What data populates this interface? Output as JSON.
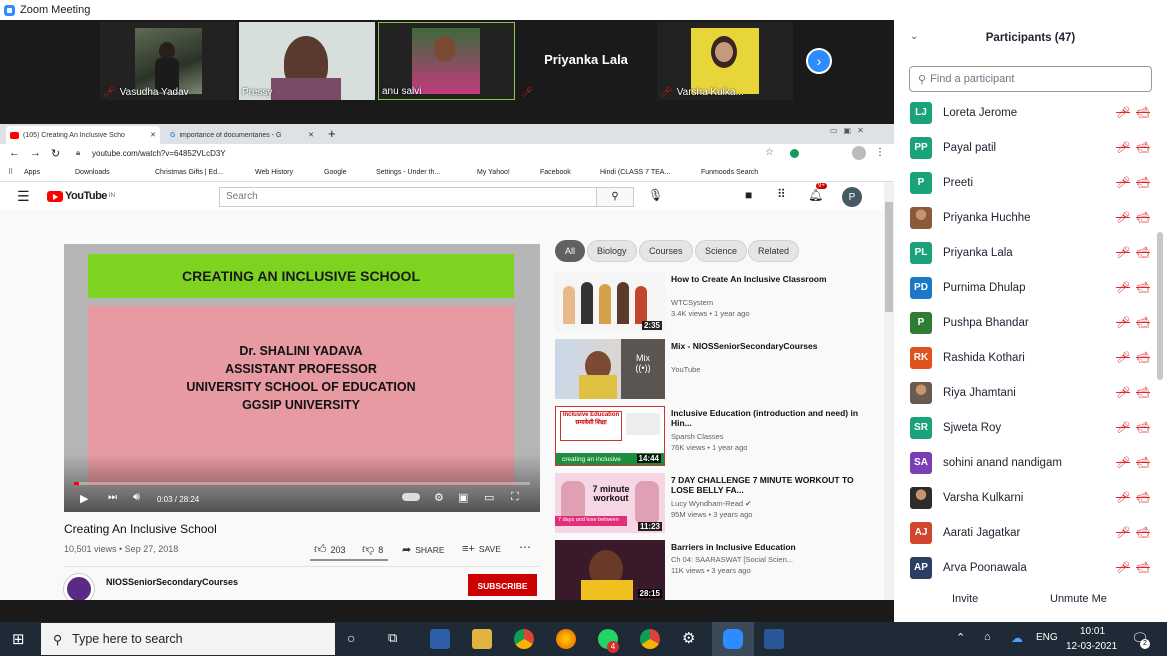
{
  "window": {
    "title": "Zoom Meeting"
  },
  "gallery": {
    "tiles": [
      {
        "name": "Vasudha Yadav"
      },
      {
        "name": "Pressy"
      },
      {
        "name": "anu salvi"
      },
      {
        "name": "Priyanka Lala"
      },
      {
        "name": "Varsha Kulka..."
      }
    ]
  },
  "browser": {
    "tabs": [
      {
        "label": "(105) Creating An Inclusive Scho"
      },
      {
        "label": "importance of documentaries - G"
      }
    ],
    "url": "youtube.com/watch?v=64852VLcD3Y",
    "bookmarks": [
      "Apps",
      "Downloads",
      "Christmas Gifts | Ed...",
      "Web History",
      "Google",
      "Settings - Under th...",
      "My Yahoo!",
      "Facebook",
      "Hindi (CLASS 7 TEA...",
      "Funmoods Search"
    ]
  },
  "youtube": {
    "logo": "YouTube",
    "logo_sup": "IN",
    "search_placeholder": "Search",
    "notif_count": "9+",
    "avatar": "P",
    "chips": [
      "All",
      "Biology",
      "Courses",
      "Science",
      "Related"
    ],
    "video": {
      "slide_heading": "CREATING AN INCLUSIVE SCHOOL",
      "slide_lines": [
        "Dr. SHALINI YADAVA",
        "ASSISTANT PROFESSOR",
        "UNIVERSITY SCHOOL OF EDUCATION",
        "GGSIP UNIVERSITY"
      ],
      "time": "0:03 / 28:24",
      "title": "Creating An Inclusive School",
      "meta": "10,501 views • Sep 27, 2018",
      "likes": "203",
      "dislikes": "8",
      "share": "SHARE",
      "save": "SAVE",
      "channel": "NIOSSeniorSecondaryCourses",
      "subscribe": "SUBSCRIBE"
    },
    "recommendations": [
      {
        "title": "How to Create An Inclusive Classroom",
        "channel": "WTCSystem",
        "meta": "3.4K views • 1 year ago",
        "duration": "2:35"
      },
      {
        "title": "Mix - NIOSSeniorSecondaryCourses",
        "channel": "YouTube",
        "meta": "",
        "duration": "",
        "mix_label": "Mix"
      },
      {
        "title": "Inclusive Education (introduction and need) in Hin...",
        "channel": "Sparsh Classes",
        "meta": "76K views • 1 year ago",
        "duration": "14:44",
        "thumb_text": "Inclusive Education",
        "thumb_text2": "समावेशी शिक्षा",
        "thumb_text3": "creating an inclusive"
      },
      {
        "title": "7 DAY CHALLENGE 7 MINUTE WORKOUT TO LOSE BELLY FA...",
        "channel": "Lucy Wyndham-Read",
        "meta": "95M views • 3 years ago",
        "duration": "11:23",
        "thumb_text": "7 minute workout",
        "thumb_text2": "7 days and lose between"
      },
      {
        "title": "Barriers in Inclusive Education",
        "channel": "Ch 04: SAARASWAT [Social Scien...",
        "meta": "11K views • 3 years ago",
        "duration": "28:15"
      }
    ]
  },
  "participants": {
    "header": "Participants (47)",
    "search_placeholder": "Find a participant",
    "list": [
      {
        "initials": "LJ",
        "name": "Loreta Jerome",
        "color": "#1aa37a"
      },
      {
        "initials": "PP",
        "name": "Payal patil",
        "color": "#1aa37a"
      },
      {
        "initials": "P",
        "name": "Preeti",
        "color": "#1aa37a"
      },
      {
        "initials": "",
        "name": "Priyanka Huchhe",
        "color": "#8a5a3a",
        "photo": true
      },
      {
        "initials": "PL",
        "name": "Priyanka Lala",
        "color": "#1aa37a"
      },
      {
        "initials": "PD",
        "name": "Purnima Dhulap",
        "color": "#1b78c8"
      },
      {
        "initials": "P",
        "name": "Pushpa Bhandar",
        "color": "#2e7d32"
      },
      {
        "initials": "RK",
        "name": "Rashida Kothari",
        "color": "#e0531f"
      },
      {
        "initials": "",
        "name": "Riya Jhamtani",
        "color": "#6b5a50",
        "photo": true
      },
      {
        "initials": "SR",
        "name": "Sjweta Roy",
        "color": "#1aa37a"
      },
      {
        "initials": "SA",
        "name": "sohini anand nandigam",
        "color": "#7b3fb5"
      },
      {
        "initials": "",
        "name": "Varsha Kulkarni",
        "color": "#2c2c2c",
        "photo": true
      },
      {
        "initials": "AJ",
        "name": "Aarati Jagatkar",
        "color": "#d1462f"
      },
      {
        "initials": "AP",
        "name": "Arva Poonawala",
        "color": "#2c3e63"
      }
    ],
    "invite": "Invite",
    "unmute": "Unmute Me"
  },
  "taskbar": {
    "search_placeholder": "Type here to search",
    "lang": "ENG",
    "time": "10:01",
    "date": "12-03-2021",
    "whatsapp_badge": "4",
    "notif_badge": "2"
  }
}
